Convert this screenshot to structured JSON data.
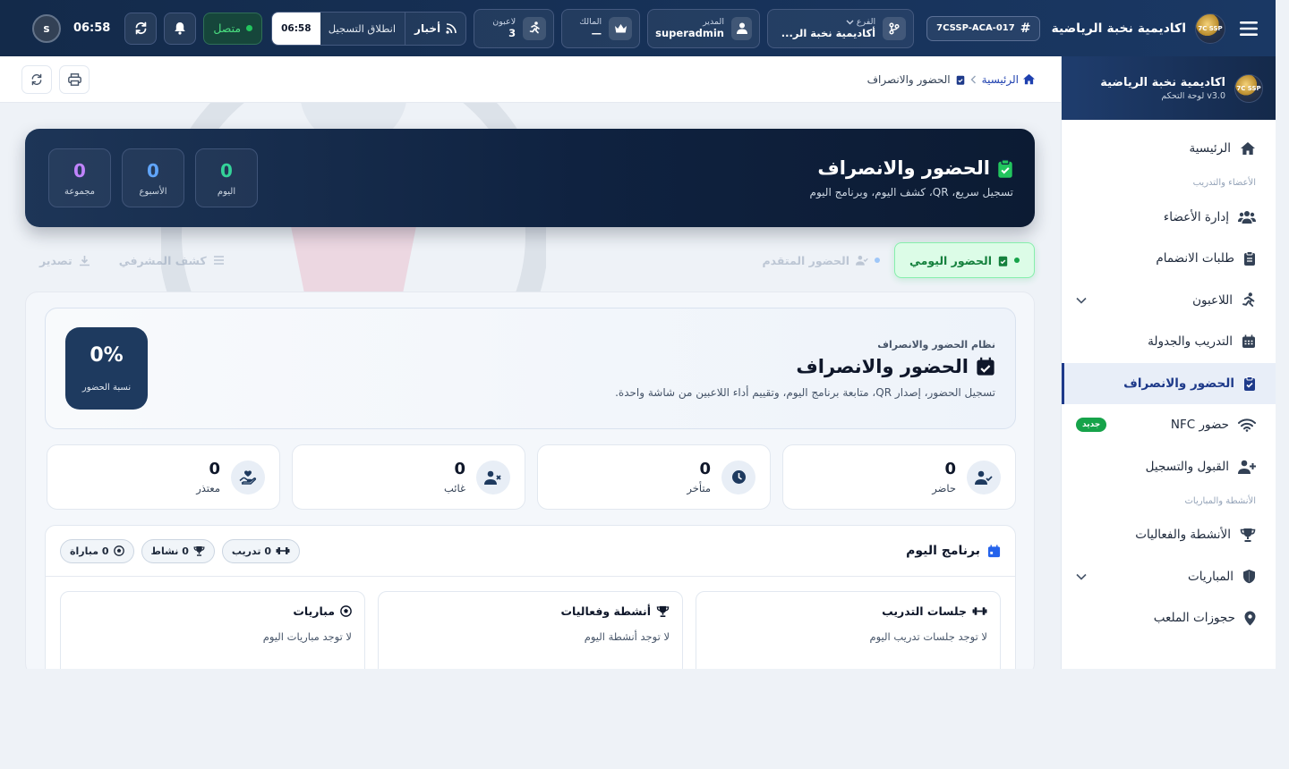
{
  "topbar": {
    "brand_name": "اكاديمية نخبة الرياضية",
    "logo_text": "7C SSP",
    "code_hash": "#",
    "code": "7CSSP-ACA-017",
    "branch_label": "الفرع",
    "branch_value": "أكاديمية نخبة الر...",
    "manager_label": "المدير",
    "manager_value": "superadmin",
    "owner_label": "المالك",
    "owner_value": "—",
    "players_label": "لاعبون",
    "players_value": "3",
    "news_label": "أخبار",
    "news_text": "انطلاق التسجيل",
    "news_time": "06:58",
    "online_label": "متصل",
    "clock": "06:58",
    "avatar_letter": "s"
  },
  "sidebar": {
    "title": "اكاديمية نخبة الرياضية",
    "subtitle": "v3.0 لوحة التحكم",
    "items": [
      {
        "label": "الرئيسية"
      },
      {
        "section": "الأعضاء والتدريب"
      },
      {
        "label": "إدارة الأعضاء"
      },
      {
        "label": "طلبات الانضمام"
      },
      {
        "label": "اللاعبون"
      },
      {
        "label": "التدريب والجدولة"
      },
      {
        "label": "الحضور والانصراف"
      },
      {
        "label": "حضور NFC",
        "badge": "جديد"
      },
      {
        "label": "القبول والتسجيل"
      },
      {
        "section": "الأنشطة والمباريات"
      },
      {
        "label": "الأنشطة والفعاليات"
      },
      {
        "label": "المباريات"
      },
      {
        "label": "حجوزات الملعب"
      }
    ]
  },
  "breadcrumb": {
    "home": "الرئيسية",
    "current": "الحضور والانصراف"
  },
  "hero": {
    "title": "الحضور والانصراف",
    "subtitle": "تسجيل سريع، QR، كشف اليوم، وبرنامج اليوم",
    "stats": [
      {
        "label": "اليوم",
        "value": "0",
        "color": "#34d399"
      },
      {
        "label": "الأسبوع",
        "value": "0",
        "color": "#60a5fa"
      },
      {
        "label": "مجموعة",
        "value": "0",
        "color": "#c084fc"
      }
    ]
  },
  "tabs": {
    "daily": "الحضور اليومي",
    "advanced": "الحضور المتقدم",
    "report": "كشف المشرفي",
    "export": "تصدير"
  },
  "system": {
    "eyebrow": "نظام الحضور والانصراف",
    "title": "الحضور والانصراف",
    "description": "تسجيل الحضور، إصدار QR، متابعة برنامج اليوم، وتقييم أداء اللاعبين من شاشة واحدة.",
    "rate_value": "0%",
    "rate_label": "نسبة الحضور"
  },
  "stats": [
    {
      "label": "حاضر",
      "value": "0",
      "icon": "user-check-icon"
    },
    {
      "label": "متأخر",
      "value": "0",
      "icon": "clock-icon"
    },
    {
      "label": "غائب",
      "value": "0",
      "icon": "user-x-icon"
    },
    {
      "label": "معتذر",
      "value": "0",
      "icon": "hand-heart-icon"
    }
  ],
  "program": {
    "title": "برنامج اليوم",
    "pills": {
      "training": "0 تدريب",
      "activities": "0 نشاط",
      "matches": "0 مباراة"
    },
    "columns": [
      {
        "title": "جلسات التدريب",
        "empty": "لا توجد جلسات تدريب اليوم"
      },
      {
        "title": "أنشطة وفعاليات",
        "empty": "لا توجد أنشطة اليوم"
      },
      {
        "title": "مباريات",
        "empty": "لا توجد مباريات اليوم"
      }
    ]
  },
  "colors": {
    "accent": "#1e3a8a",
    "success": "#16a34a",
    "topbar": "#132a4a"
  }
}
